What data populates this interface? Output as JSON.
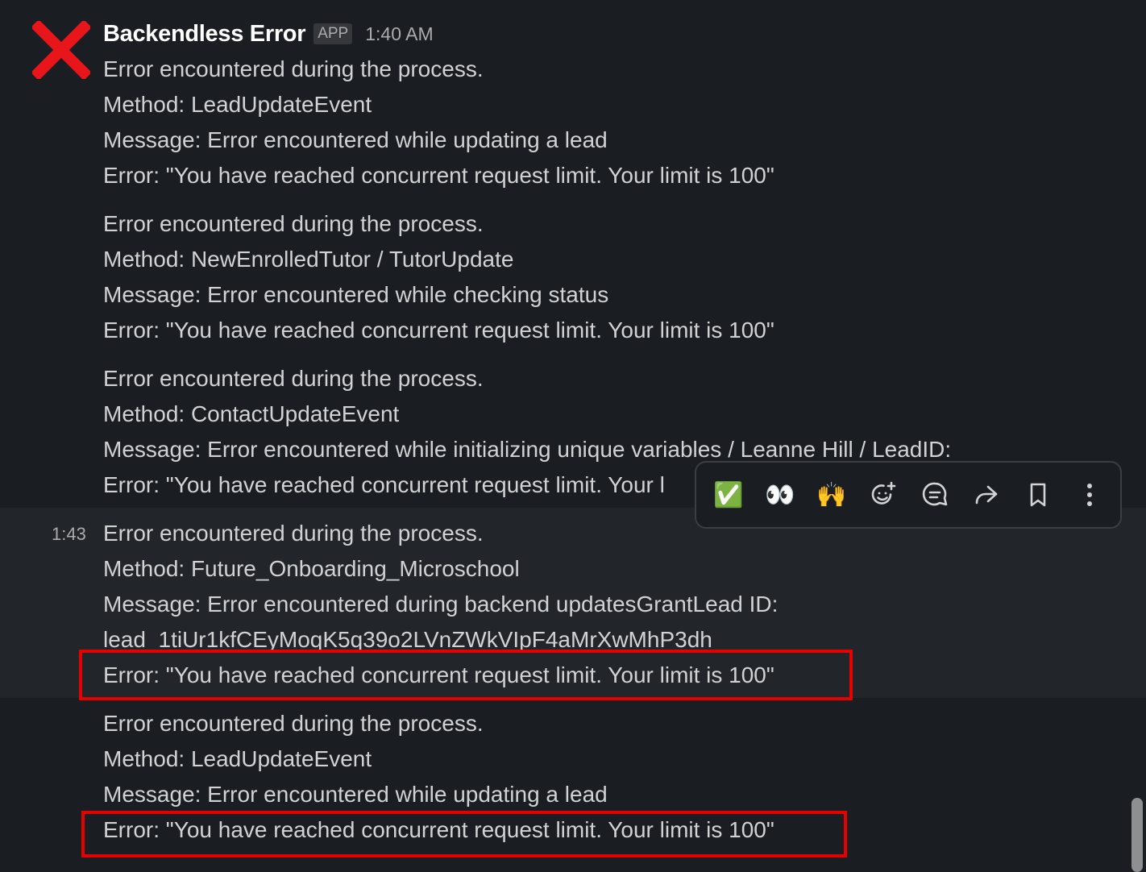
{
  "message": {
    "sender": "Backendless Error",
    "badge": "APP",
    "time": "1:40 AM"
  },
  "blocks": [
    {
      "lines": [
        "Error encountered during the process.",
        "Method: LeadUpdateEvent",
        "Message: Error encountered while updating a lead",
        "Error: \"You have reached concurrent request limit. Your limit is 100\""
      ]
    },
    {
      "lines": [
        "Error encountered during the process.",
        "Method: NewEnrolledTutor / TutorUpdate",
        "Message: Error encountered while checking status",
        "Error: \"You have reached concurrent request limit. Your limit is 100\""
      ]
    },
    {
      "lines": [
        "Error encountered during the process.",
        "Method: ContactUpdateEvent",
        "Message: Error encountered while initializing unique variables / Leanne Hill / LeadID:",
        "Error: \"You have reached concurrent request limit. Your l"
      ]
    },
    {
      "side_time": "1:43",
      "lines": [
        "Error encountered during the process.",
        "Method: Future_Onboarding_Microschool",
        "Message: Error encountered during backend updatesGrantLead ID:",
        "lead_1tiUr1kfCEyMoqK5q39o2LVnZWkVIpF4aMrXwMhP3dh",
        "Error: \"You have reached concurrent request limit. Your limit is 100\""
      ]
    },
    {
      "lines": [
        "Error encountered during the process.",
        "Method: LeadUpdateEvent",
        "Message: Error encountered while updating a lead",
        "Error: \"You have reached concurrent request limit. Your limit is 100\""
      ]
    }
  ],
  "toolbar": {
    "actions": [
      {
        "name": "check-mark-reaction",
        "glyph": "✅"
      },
      {
        "name": "eyes-reaction",
        "glyph": "👀"
      },
      {
        "name": "raised-hands-reaction",
        "glyph": "🙌"
      },
      {
        "name": "add-reaction-icon",
        "glyph": ""
      },
      {
        "name": "reply-in-thread-icon",
        "glyph": ""
      },
      {
        "name": "share-message-icon",
        "glyph": ""
      },
      {
        "name": "save-bookmark-icon",
        "glyph": ""
      },
      {
        "name": "more-actions-icon",
        "glyph": ""
      }
    ]
  },
  "colors": {
    "background": "#1a1d21",
    "hover_background": "#222529",
    "highlight_box": "#e60000",
    "avatar_x": "#e8161b"
  }
}
